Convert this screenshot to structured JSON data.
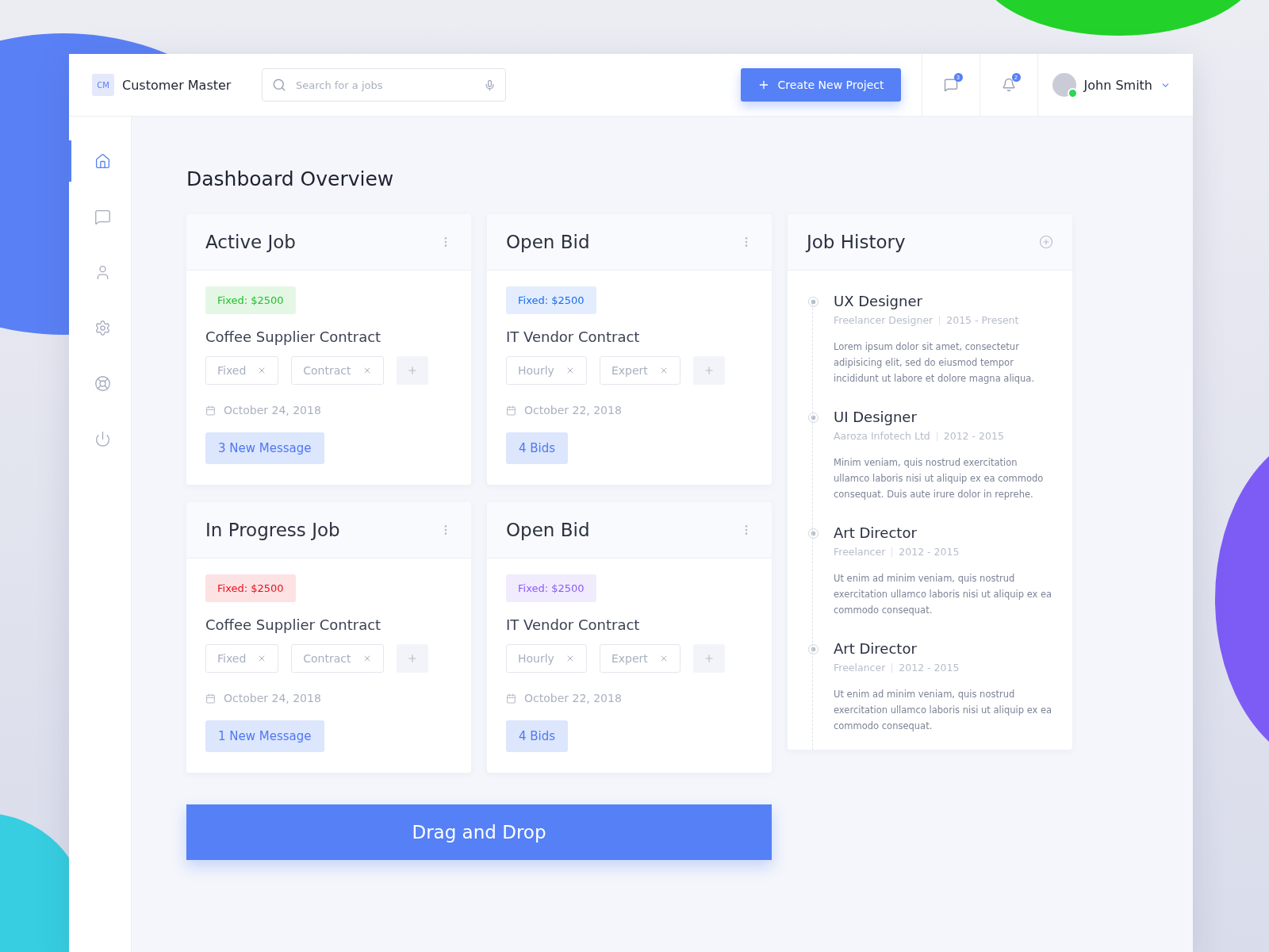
{
  "brand": {
    "logo": "CM",
    "name": "Customer Master"
  },
  "search": {
    "placeholder": "Search for a jobs"
  },
  "create_button": "Create New Project",
  "notifications": [
    {
      "kind": "messages",
      "count": "3"
    },
    {
      "kind": "alerts",
      "count": "2"
    }
  ],
  "user": {
    "name": "John Smith",
    "online": true
  },
  "sidebar": {
    "items": [
      {
        "kind": "home",
        "selected": true
      },
      {
        "kind": "chat",
        "selected": false
      },
      {
        "kind": "user",
        "selected": false
      },
      {
        "kind": "settings",
        "selected": false
      },
      {
        "kind": "support",
        "selected": false
      },
      {
        "kind": "power",
        "selected": false
      }
    ]
  },
  "page_title": "Dashboard Overview",
  "cards": [
    {
      "title": "Active Job",
      "price": "Fixed: $2500",
      "color": "#22c02a",
      "name": "Coffee Supplier Contract",
      "tags": [
        "Fixed",
        "Contract"
      ],
      "date": "October 24, 2018",
      "action": "3 New Message"
    },
    {
      "title": "Open Bid",
      "price": "Fixed: $2500",
      "color": "#1a6cf0",
      "name": "IT Vendor Contract",
      "tags": [
        "Hourly",
        "Expert"
      ],
      "date": "October 22, 2018",
      "action": "4 Bids"
    },
    {
      "title": "In Progress Job",
      "price": "Fixed: $2500",
      "color": "#e8101c",
      "name": "Coffee Supplier Contract",
      "tags": [
        "Fixed",
        "Contract"
      ],
      "date": "October 24, 2018",
      "action": "1 New Message"
    },
    {
      "title": "Open Bid",
      "price": "Fixed: $2500",
      "color": "#8a5cf5",
      "name": "IT Vendor Contract",
      "tags": [
        "Hourly",
        "Expert"
      ],
      "date": "October 22, 2018",
      "action": "4 Bids"
    }
  ],
  "job_history": {
    "title": "Job History",
    "entries": [
      {
        "role": "UX Designer",
        "company": "Freelancer Designer",
        "period": "2015 - Present",
        "text": "Lorem ipsum dolor sit amet, consectetur adipisicing elit, sed do eiusmod tempor incididunt ut labore et dolore magna aliqua."
      },
      {
        "role": "UI Designer",
        "company": "Aaroza Infotech Ltd",
        "period": "2012 - 2015",
        "text": "Minim veniam, quis nostrud exercitation ullamco laboris nisi ut aliquip ex ea commodo consequat. Duis aute irure dolor in reprehe."
      },
      {
        "role": "Art Director",
        "company": "Freelancer",
        "period": "2012 - 2015",
        "text": "Ut enim ad minim veniam, quis nostrud exercitation ullamco laboris nisi ut aliquip ex ea commodo consequat."
      },
      {
        "role": "Art Director",
        "company": "Freelancer",
        "period": "2012 - 2015",
        "text": "Ut enim ad minim veniam, quis nostrud exercitation ullamco laboris nisi ut aliquip ex ea commodo consequat."
      }
    ]
  },
  "drag_button": "Drag and Drop"
}
